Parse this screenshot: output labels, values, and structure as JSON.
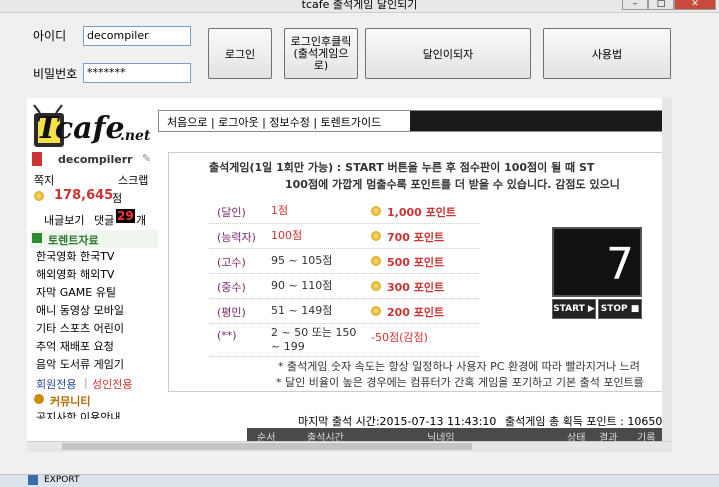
{
  "window": {
    "title": "tcafe 출석게임 달인되기",
    "min": "–",
    "max": "□",
    "close": "✕"
  },
  "login": {
    "id_label": "아이디",
    "id_value": "decompiler",
    "pw_label": "비밀번호",
    "pw_value": "*******",
    "login_btn": "로그인",
    "login_click_btn": "로그인후클릭 (출석게임으로)",
    "master_btn": "달인이되자",
    "usage_btn": "사용법"
  },
  "site": {
    "logo_text": "Tcafe",
    "logo_suffix": ".net",
    "menu": "처음으로 | 로그아웃 | 정보수정 | 토렌트가이드"
  },
  "sidebar": {
    "username": "decompilerr",
    "note_label": "쪽지",
    "scrap_label": "스크랩",
    "points": "178,645",
    "points_unit": "점",
    "my_posts": "내글보기",
    "comments_label": "댓글",
    "comments_count": "29",
    "comments_unit": "개",
    "torrent_header": "토렌트자료",
    "torrent_rows": [
      "한국영화 한국TV",
      "해외영화 해외TV",
      "자막 GAME 유틸",
      "애니 동영상 모바일",
      "기타 스포츠 어린이",
      "추억 재배포 요청",
      "음악 도서류 게임기"
    ],
    "members_only": "회원전용",
    "adult_only": "성인전용",
    "community_header": "커뮤니티",
    "community_row": "공지사항 이용안내"
  },
  "game": {
    "intro_line1": "출석게임(1일 1회만 가능) : START 버튼을 누른 후 점수판이 100점이 될 때 ST",
    "intro_line2": "100점에 가깝게 멈출수록 포인트를 더 받을 수 있습니다. 감점도 있으니",
    "rows": [
      {
        "grade": "(달인)",
        "score": "1점",
        "reward": "1,000 포인트"
      },
      {
        "grade": "(능력자)",
        "score": "100점",
        "reward": "700 포인트"
      },
      {
        "grade": "(고수)",
        "score": "95 ~ 105점",
        "reward": "500 포인트"
      },
      {
        "grade": "(중수)",
        "score": "90 ~ 110점",
        "reward": "300 포인트"
      },
      {
        "grade": "(평민)",
        "score": "51 ~ 149점",
        "reward": "200 포인트"
      },
      {
        "grade": "(**)",
        "score": "2 ~ 50 또는 150 ~ 199",
        "reward": "-50점(감점)"
      }
    ],
    "board_value": "7",
    "start_btn": "START ▶",
    "stop_btn": "STOP ■",
    "note1": "* 출석게임 숫자 속도는 항상 일정하나 사용자 PC 환경에 따라 빨라지거나 느려",
    "note2": "* 달인 비율이 높은 경우에는 컴퓨터가 간혹 게임을 포기하고 기본 출석 포인트를",
    "last_time": "마지막 출석 시간:2015-07-13 11:43:10",
    "total_points": "출석게임 총 획득 포인트 : 10650",
    "table_headers": [
      "순서",
      "출석시간",
      "닉네임",
      "상태",
      "결과",
      "기록"
    ]
  },
  "taskbar": {
    "item": "EXPORT"
  }
}
